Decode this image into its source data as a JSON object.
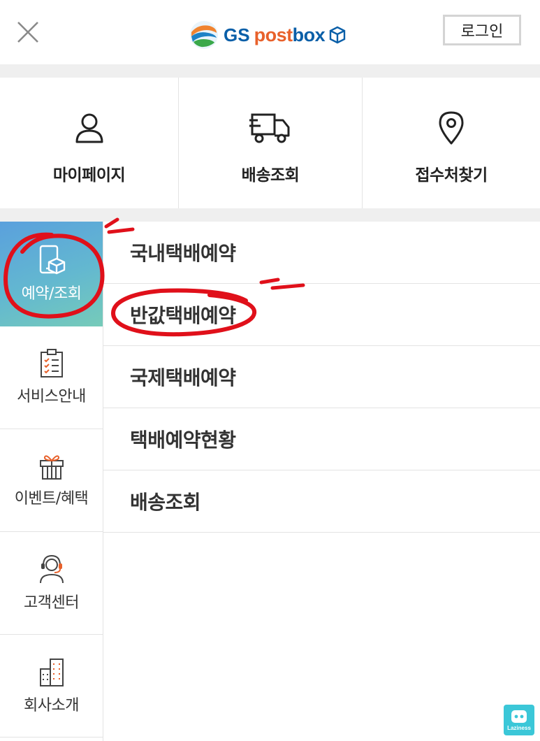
{
  "header": {
    "close_icon": "close-icon",
    "logo": {
      "gs": "GS",
      "post": "post",
      "box": "box"
    },
    "login_label": "로그인"
  },
  "quick_menu": [
    {
      "label": "마이페이지",
      "icon": "user-icon"
    },
    {
      "label": "배송조회",
      "icon": "delivery-truck-icon"
    },
    {
      "label": "접수처찾기",
      "icon": "location-pin-icon"
    }
  ],
  "sidebar": {
    "items": [
      {
        "label": "예약/조회",
        "icon": "phone-box-icon",
        "active": true
      },
      {
        "label": "서비스안내",
        "icon": "clipboard-checklist-icon",
        "active": false
      },
      {
        "label": "이벤트/혜택",
        "icon": "gift-icon",
        "active": false
      },
      {
        "label": "고객센터",
        "icon": "headset-agent-icon",
        "active": false
      },
      {
        "label": "회사소개",
        "icon": "building-icon",
        "active": false
      }
    ]
  },
  "submenu": {
    "items": [
      {
        "label": "국내택배예약"
      },
      {
        "label": "반값택배예약"
      },
      {
        "label": "국제택배예약"
      },
      {
        "label": "택배예약현황"
      },
      {
        "label": "배송조회"
      }
    ]
  },
  "watermark": {
    "label": "Laziness"
  },
  "colors": {
    "accent_gradient_start": "#5aa0dd",
    "accent_gradient_end": "#76cbb9",
    "annotation_red": "#e0101a",
    "brand_orange": "#e8612b",
    "brand_blue": "#0a5fa8"
  }
}
